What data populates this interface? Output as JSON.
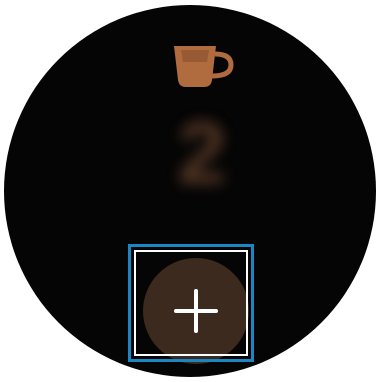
{
  "tracker": {
    "icon": "coffee-cup-icon",
    "count": "2",
    "unit": "",
    "caption": "",
    "add_button": {
      "icon": "plus-icon"
    }
  },
  "colors": {
    "background": "#050505",
    "accent": "#b06b3f",
    "button": "#3d2a1e",
    "highlight": "#1a87c4"
  }
}
